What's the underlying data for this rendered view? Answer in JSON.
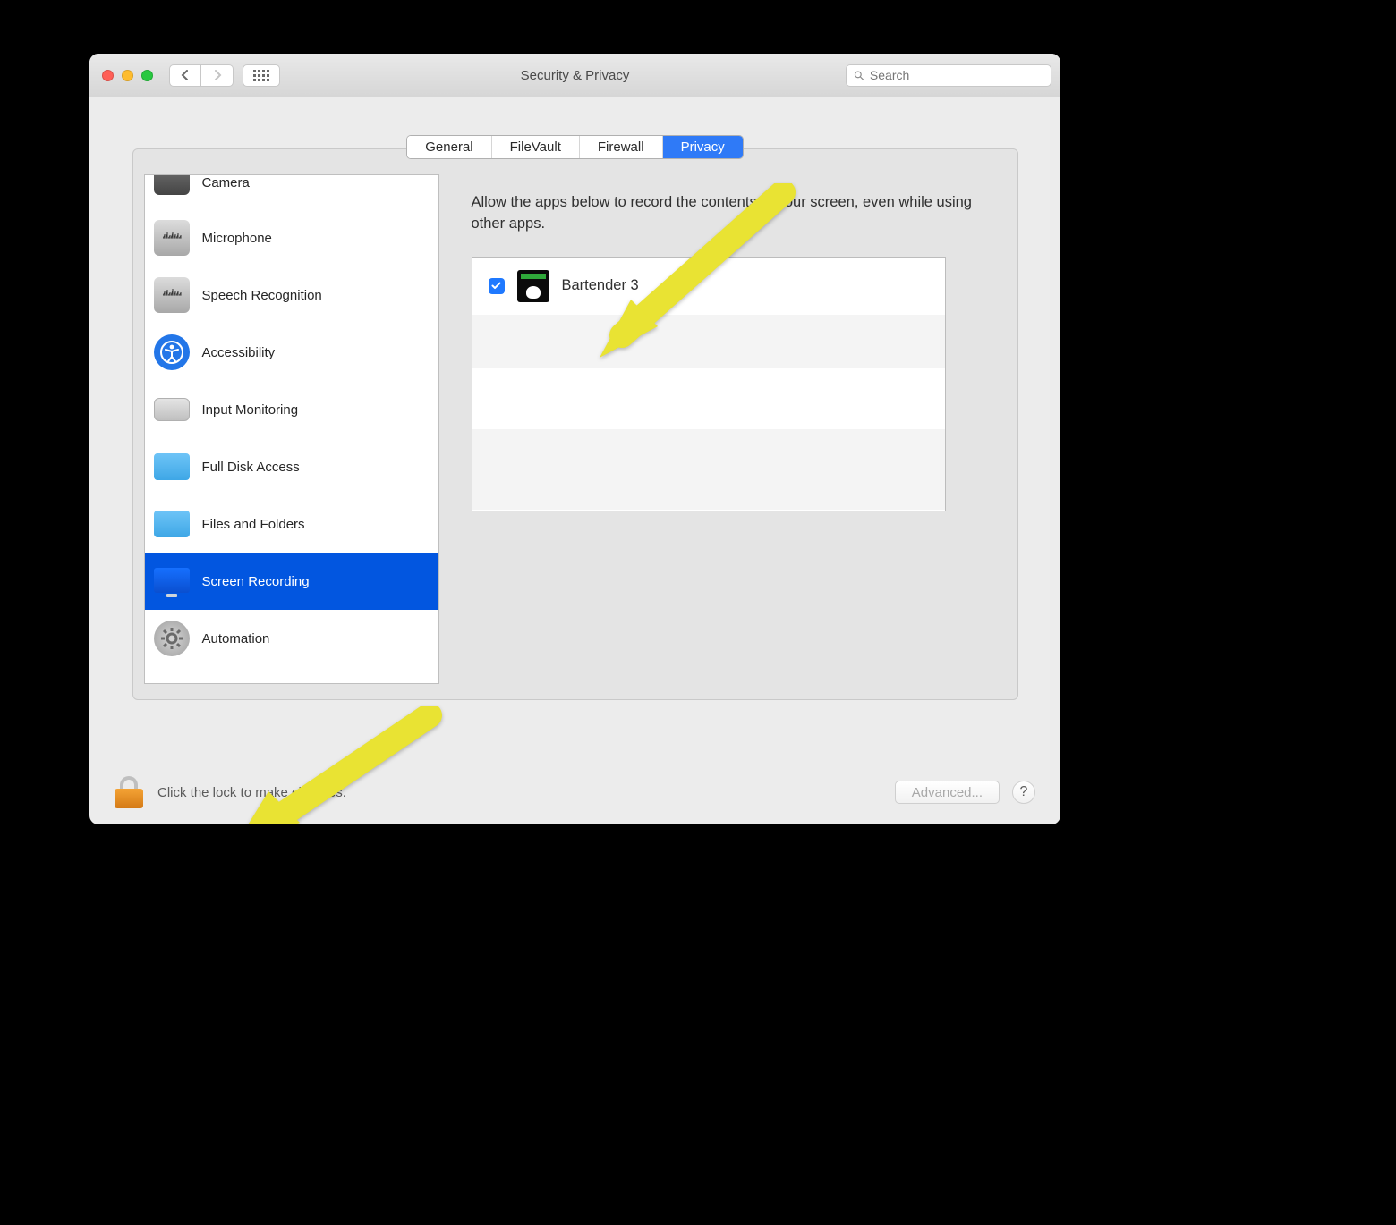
{
  "window_title": "Security & Privacy",
  "search_placeholder": "Search",
  "tabs": {
    "general": "General",
    "filevault": "FileVault",
    "firewall": "Firewall",
    "privacy": "Privacy"
  },
  "sidebar": {
    "camera": "Camera",
    "microphone": "Microphone",
    "speech": "Speech Recognition",
    "accessibility": "Accessibility",
    "input": "Input Monitoring",
    "fulldisk": "Full Disk Access",
    "files": "Files and Folders",
    "screen": "Screen Recording",
    "automation": "Automation"
  },
  "right_pane": {
    "description": "Allow the apps below to record the contents of your screen, even while using other apps.",
    "apps": [
      {
        "name": "Bartender 3",
        "checked": true
      }
    ]
  },
  "footer": {
    "lock_text": "Click the lock to make changes.",
    "advanced": "Advanced...",
    "help": "?"
  }
}
